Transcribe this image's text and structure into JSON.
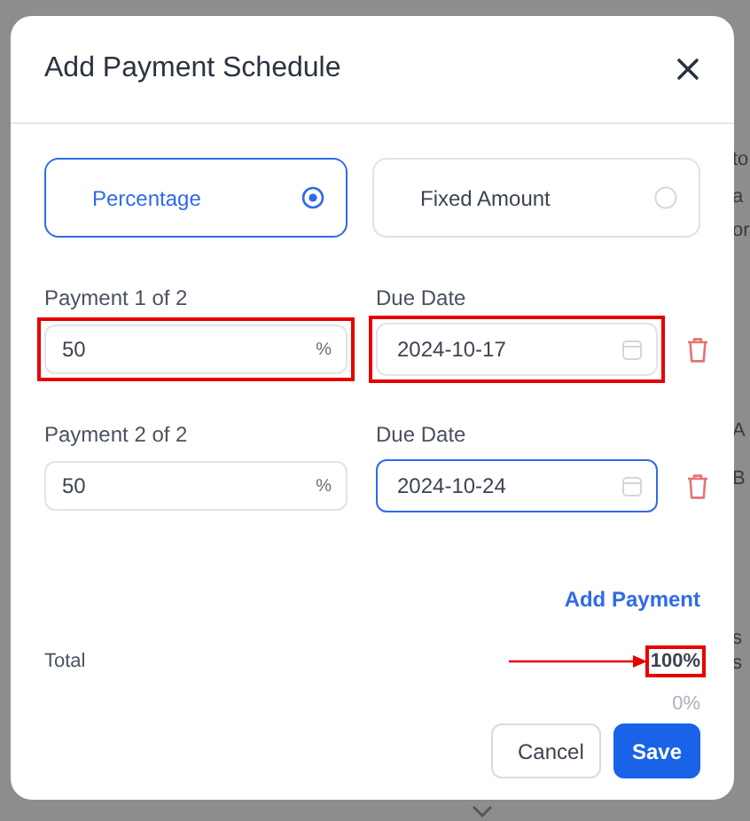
{
  "dialog": {
    "title": "Add Payment Schedule"
  },
  "options": [
    {
      "label": "Percentage",
      "selected": true
    },
    {
      "label": "Fixed Amount",
      "selected": false
    }
  ],
  "payments": [
    {
      "label": "Payment 1 of 2",
      "amount": "50",
      "unit": "%",
      "amount_highlighted": true,
      "date_label": "Due Date",
      "date": "2024-10-17",
      "date_highlighted": true,
      "date_focused": false
    },
    {
      "label": "Payment 2 of 2",
      "amount": "50",
      "unit": "%",
      "amount_highlighted": false,
      "date_label": "Due Date",
      "date": "2024-10-24",
      "date_highlighted": false,
      "date_focused": true
    }
  ],
  "add_payment": "Add Payment",
  "total": {
    "label": "Total",
    "value": "100%",
    "highlighted": true,
    "arrow": true,
    "remaining": "0%"
  },
  "buttons": [
    {
      "label": "Cancel",
      "kind": "secondary"
    },
    {
      "label": "Save",
      "kind": "primary"
    }
  ],
  "backdrop": {
    "fragments": [
      "to",
      "a",
      "or",
      "A",
      "B",
      "s",
      "s"
    ]
  }
}
